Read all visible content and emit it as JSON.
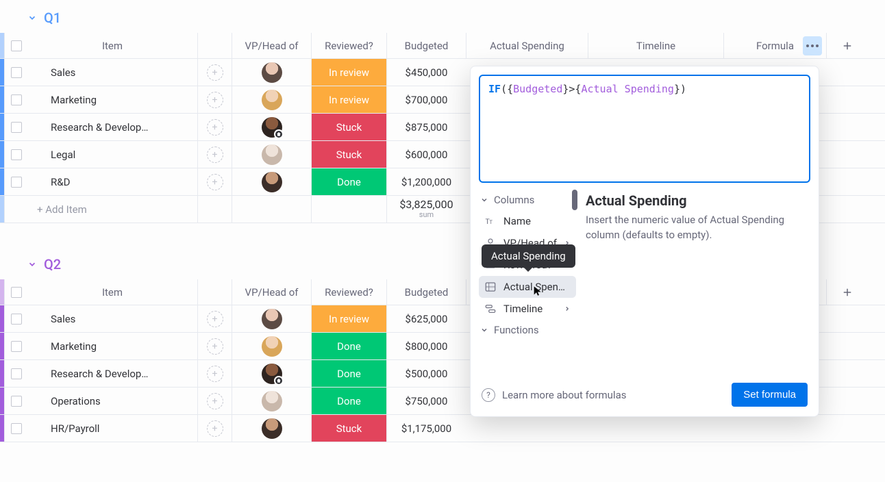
{
  "groups": {
    "q1": {
      "title": "Q1",
      "columns": {
        "item": "Item",
        "vp": "VP/Head of",
        "reviewed": "Reviewed?",
        "budgeted": "Budgeted",
        "spending": "Actual Spending",
        "timeline": "Timeline",
        "formula": "Formula"
      },
      "rows": [
        {
          "name": "Sales",
          "avatar": "av1",
          "status": "In review",
          "statusClass": "st-review",
          "budgeted": "$450,000"
        },
        {
          "name": "Marketing",
          "avatar": "av2",
          "status": "In review",
          "statusClass": "st-review",
          "budgeted": "$700,000"
        },
        {
          "name": "Research & Develop…",
          "avatar": "av3",
          "badge": true,
          "status": "Stuck",
          "statusClass": "st-stuck",
          "budgeted": "$875,000"
        },
        {
          "name": "Legal",
          "avatar": "av4",
          "status": "Stuck",
          "statusClass": "st-stuck",
          "budgeted": "$600,000"
        },
        {
          "name": "R&D",
          "avatar": "av5",
          "status": "Done",
          "statusClass": "st-done",
          "budgeted": "$1,200,000"
        }
      ],
      "addItem": "+ Add Item",
      "sum": "$3,825,000",
      "sumLabel": "sum"
    },
    "q2": {
      "title": "Q2",
      "columns": {
        "item": "Item",
        "vp": "VP/Head of",
        "reviewed": "Reviewed?",
        "budgeted": "Budgeted"
      },
      "rows": [
        {
          "name": "Sales",
          "avatar": "av1",
          "status": "In review",
          "statusClass": "st-review",
          "budgeted": "$625,000"
        },
        {
          "name": "Marketing",
          "avatar": "av2",
          "status": "Done",
          "statusClass": "st-done",
          "budgeted": "$800,000"
        },
        {
          "name": "Research & Develop…",
          "avatar": "av3",
          "badge": true,
          "status": "Done",
          "statusClass": "st-done",
          "budgeted": "$500,000"
        },
        {
          "name": "Operations",
          "avatar": "av4",
          "status": "Done",
          "statusClass": "st-done",
          "budgeted": "$750,000"
        },
        {
          "name": "HR/Payroll",
          "avatar": "av5",
          "status": "Stuck",
          "statusClass": "st-stuck",
          "budgeted": "$1,175,000"
        }
      ]
    }
  },
  "popup": {
    "formula": {
      "keyword": "IF",
      "col1": "Budgeted",
      "col2": "Actual Spending",
      "raw_suffix": ")"
    },
    "sections": {
      "columns": "Columns",
      "functions": "Functions"
    },
    "columns_list": {
      "name": "Name",
      "vp": "VP/Head of",
      "reviewed": "Reviewed?",
      "actual": "Actual Spen…",
      "timeline": "Timeline"
    },
    "tooltip": "Actual Spending",
    "help": {
      "title": "Actual Spending",
      "desc": "Insert the numeric value of Actual Spending column (defaults to empty)."
    },
    "learn": "Learn more about formulas",
    "set": "Set formula"
  }
}
